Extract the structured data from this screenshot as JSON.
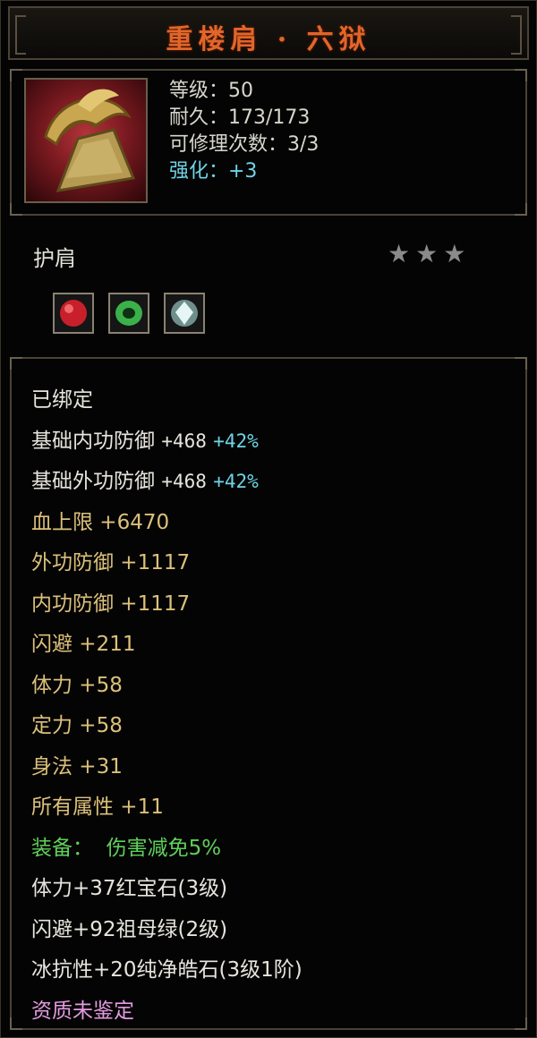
{
  "title": "重楼肩 · 六狱",
  "stats": {
    "level": "等级：50",
    "durability": "耐久：173/173",
    "repairs": "可修理次数：3/3",
    "enhance": "强化：+3"
  },
  "slot": "护肩",
  "stars": "★★★",
  "gems": [
    {
      "icon": "red-ruby-gem-icon",
      "color": "#c8202a"
    },
    {
      "icon": "green-emerald-gem-icon",
      "color": "#3bb04a"
    },
    {
      "icon": "white-diamond-gem-icon",
      "color": "#cfe8ea"
    }
  ],
  "bound": "已绑定",
  "base_inner": {
    "label": "基础内功防御",
    "value": "+468",
    "bonus": "+42%"
  },
  "base_outer": {
    "label": "基础外功防御",
    "value": "+468",
    "bonus": "+42%"
  },
  "attrs": [
    "血上限 +6470",
    "外功防御 +1117",
    "内功防御 +1117",
    "闪避 +211",
    "体力 +58",
    "定力 +58",
    "身法 +31",
    "所有属性 +11"
  ],
  "set_bonus": {
    "label": "装备：",
    "value": "伤害减免5%"
  },
  "gem_lines": [
    "体力+37红宝石(3级)",
    "闪避+92祖母绿(2级)",
    "冰抗性+20纯净皓石(3级1阶)"
  ],
  "quality": "资质未鉴定"
}
